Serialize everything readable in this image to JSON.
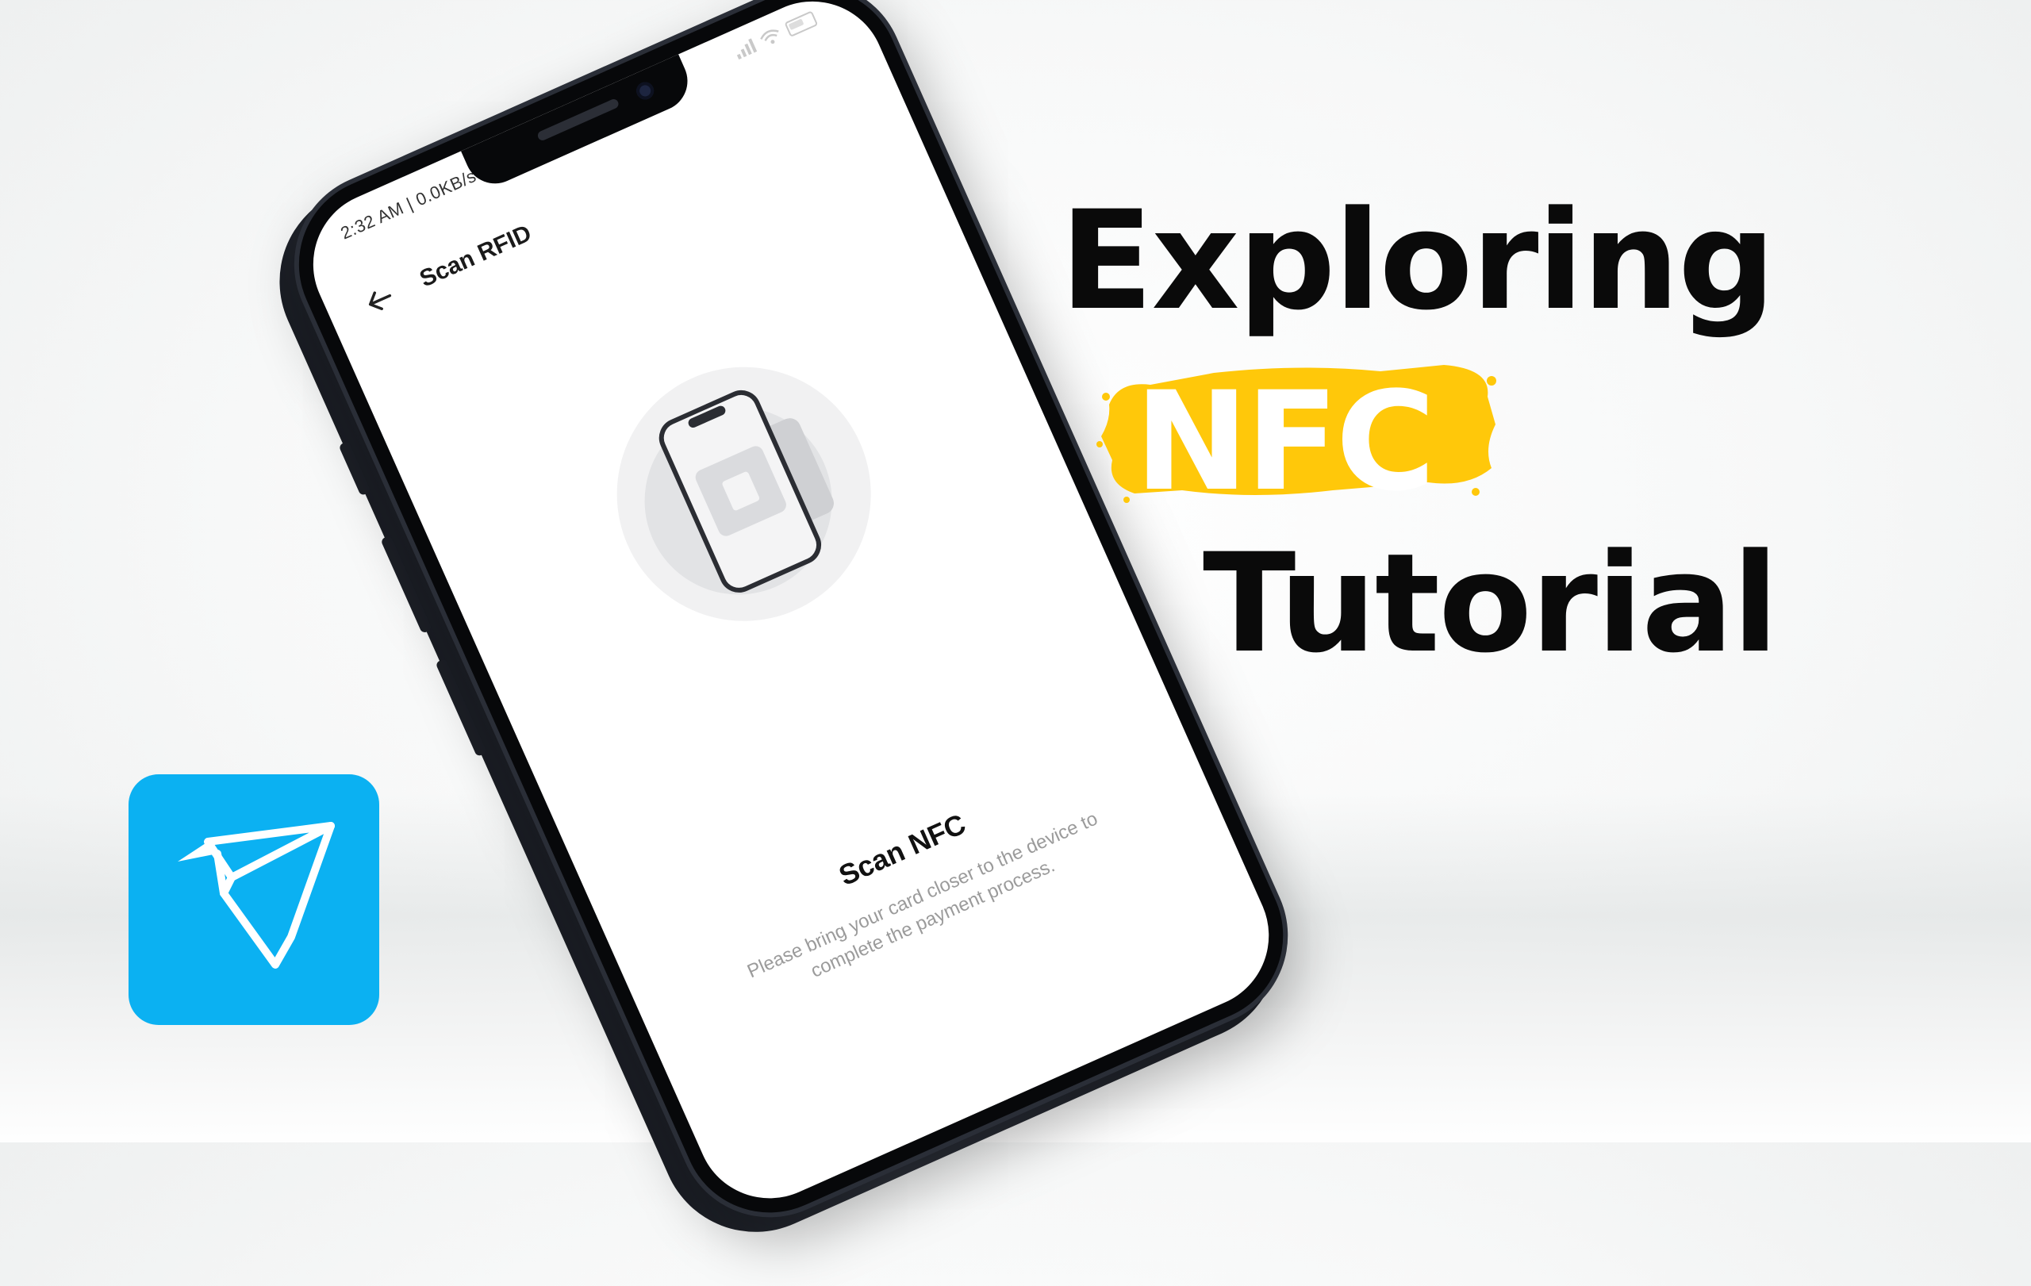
{
  "phone": {
    "status_bar": {
      "time": "2:32 AM | 0.0KB/s"
    },
    "header": {
      "back_icon": "arrow-left-icon",
      "title": "Scan RFID"
    },
    "illustration": "phone-card-tap-icon",
    "scan": {
      "title": "Scan NFC",
      "description": "Please bring your card closer to the device to complete the payment process."
    }
  },
  "headline": {
    "line1": "Exploring",
    "highlight": "NFC",
    "line3": "Tutorial",
    "highlight_color": "#FFC80A"
  },
  "logo": {
    "icon": "bird-logo-icon",
    "color": "#0BB1F2"
  }
}
